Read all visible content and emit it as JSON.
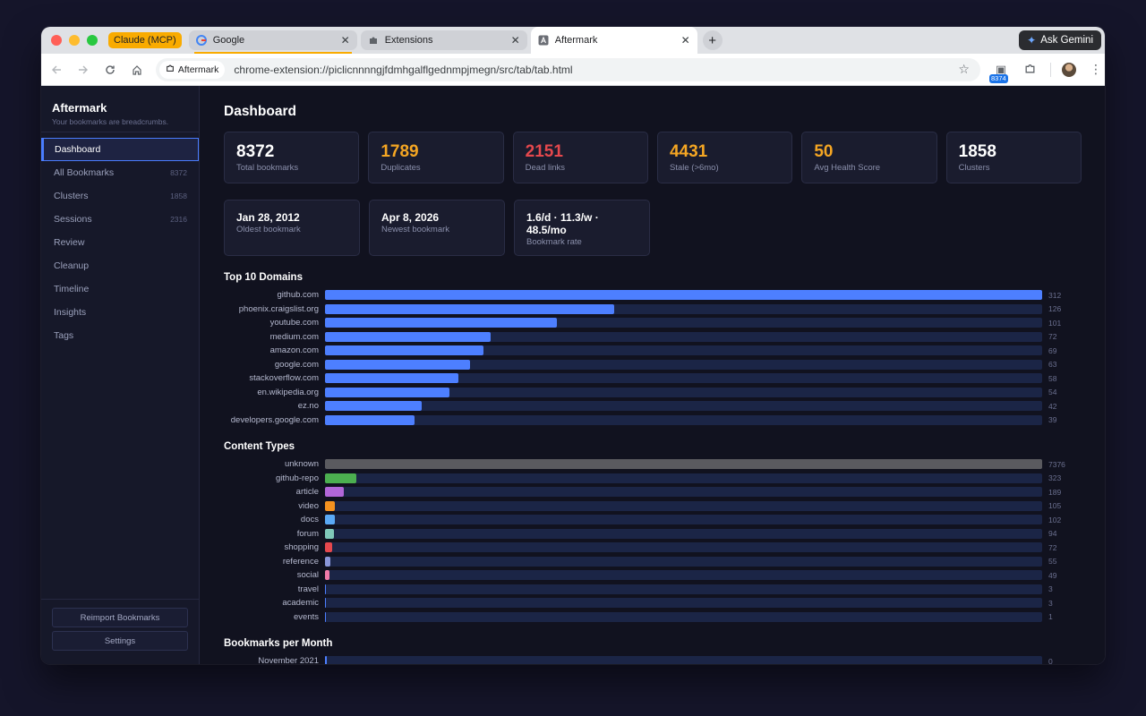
{
  "browser": {
    "group_chip": "Claude (MCP)",
    "tabs": [
      {
        "label": "Google",
        "icon": "google-icon"
      },
      {
        "label": "Extensions",
        "icon": "puzzle-icon"
      },
      {
        "label": "Aftermark",
        "icon": "aftermark-icon"
      }
    ],
    "gemini_label": "Ask Gemini",
    "site_chip": "Aftermark",
    "url": "chrome-extension://piclicnnnngjfdmhgalflgednmpjmegn/src/tab/tab.html",
    "extension_badge": "8374"
  },
  "sidebar": {
    "title": "Aftermark",
    "subtitle": "Your bookmarks are breadcrumbs.",
    "items": [
      {
        "label": "Dashboard",
        "count": ""
      },
      {
        "label": "All Bookmarks",
        "count": "8372"
      },
      {
        "label": "Clusters",
        "count": "1858"
      },
      {
        "label": "Sessions",
        "count": "2316"
      },
      {
        "label": "Review",
        "count": ""
      },
      {
        "label": "Cleanup",
        "count": ""
      },
      {
        "label": "Timeline",
        "count": ""
      },
      {
        "label": "Insights",
        "count": ""
      },
      {
        "label": "Tags",
        "count": ""
      }
    ],
    "reimport_label": "Reimport Bookmarks",
    "settings_label": "Settings"
  },
  "main": {
    "title": "Dashboard",
    "stats": [
      {
        "value": "8372",
        "label": "Total bookmarks",
        "color": "#ffffff"
      },
      {
        "value": "1789",
        "label": "Duplicates",
        "color": "#f5a623"
      },
      {
        "value": "2151",
        "label": "Dead links",
        "color": "#e5484d"
      },
      {
        "value": "4431",
        "label": "Stale (>6mo)",
        "color": "#f5a623"
      },
      {
        "value": "50",
        "label": "Avg Health Score",
        "color": "#f5a623"
      },
      {
        "value": "1858",
        "label": "Clusters",
        "color": "#ffffff"
      }
    ],
    "dates": [
      {
        "value": "Jan 28, 2012",
        "label": "Oldest bookmark"
      },
      {
        "value": "Apr 8, 2026",
        "label": "Newest bookmark"
      },
      {
        "value": "1.6/d · 11.3/w · 48.5/mo",
        "label": "Bookmark rate"
      }
    ],
    "domains_title": "Top 10 Domains",
    "content_title": "Content Types",
    "monthly_title": "Bookmarks per Month",
    "monthly_first": {
      "label": "November 2021",
      "value": "0"
    }
  },
  "chart_data": [
    {
      "type": "bar",
      "title": "Top 10 Domains",
      "orientation": "horizontal",
      "color": "#4d7fff",
      "categories": [
        "github.com",
        "phoenix.craigslist.org",
        "youtube.com",
        "medium.com",
        "amazon.com",
        "google.com",
        "stackoverflow.com",
        "en.wikipedia.org",
        "ez.no",
        "developers.google.com"
      ],
      "values": [
        312,
        126,
        101,
        72,
        69,
        63,
        58,
        54,
        42,
        39
      ]
    },
    {
      "type": "bar",
      "title": "Content Types",
      "orientation": "horizontal",
      "categories": [
        "unknown",
        "github-repo",
        "article",
        "video",
        "docs",
        "forum",
        "shopping",
        "reference",
        "social",
        "travel",
        "academic",
        "events"
      ],
      "values": [
        7376,
        323,
        189,
        105,
        102,
        94,
        72,
        55,
        49,
        3,
        3,
        1
      ],
      "colors": [
        "#5a5a5f",
        "#4caf50",
        "#b266d8",
        "#f5921f",
        "#5aa9f5",
        "#7fc8b8",
        "#e5484d",
        "#8a96d8",
        "#f07aa8",
        "#4d7fff",
        "#4d7fff",
        "#4d7fff"
      ]
    }
  ]
}
